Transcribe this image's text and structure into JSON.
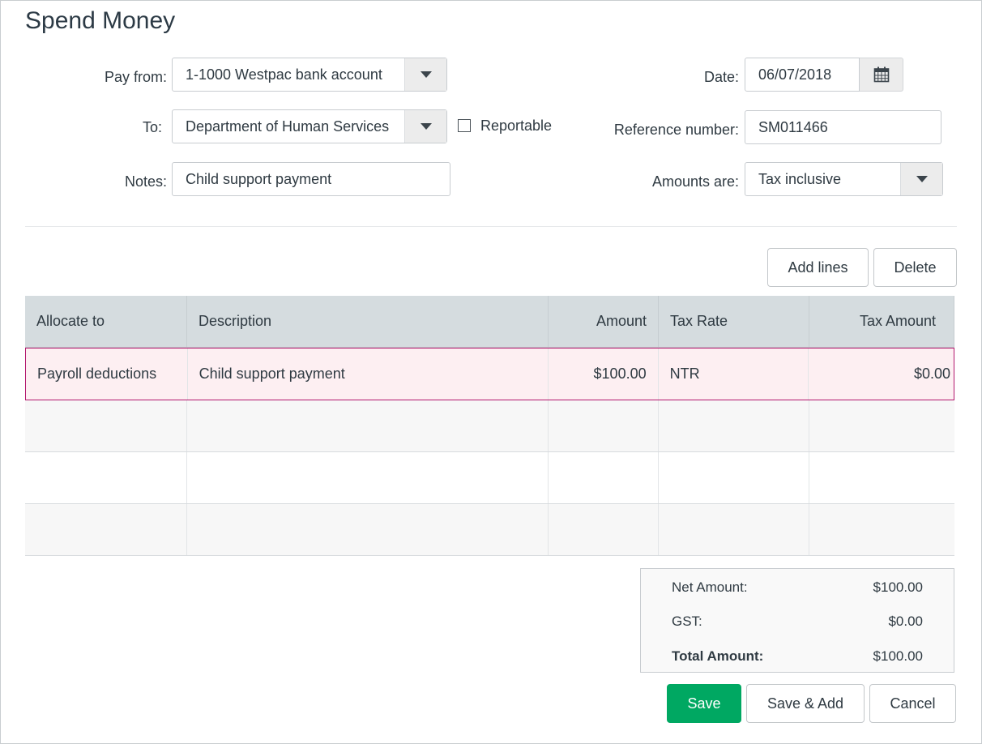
{
  "page": {
    "title": "Spend Money"
  },
  "form": {
    "pay_from": {
      "label": "Pay from:",
      "value": "1-1000 Westpac bank account"
    },
    "to": {
      "label": "To:",
      "value": "Department of Human Services"
    },
    "reportable": {
      "label": "Reportable",
      "checked": false
    },
    "notes": {
      "label": "Notes:",
      "value": "Child support payment"
    },
    "date": {
      "label": "Date:",
      "value": "06/07/2018"
    },
    "reference": {
      "label": "Reference number:",
      "value": "SM011466"
    },
    "amounts_are": {
      "label": "Amounts are:",
      "value": "Tax inclusive"
    }
  },
  "line_actions": {
    "add_lines": "Add lines",
    "delete": "Delete"
  },
  "table": {
    "columns": [
      "Allocate to",
      "Description",
      "Amount",
      "Tax Rate",
      "Tax Amount"
    ],
    "rows": [
      [
        "Payroll deductions",
        "Child support payment",
        "$100.00",
        "NTR",
        "$0.00"
      ]
    ]
  },
  "totals": {
    "net_label": "Net Amount:",
    "net_value": "$100.00",
    "gst_label": "GST:",
    "gst_value": "$0.00",
    "total_label": "Total Amount:",
    "total_value": "$100.00"
  },
  "footer": {
    "save": "Save",
    "save_add": "Save & Add",
    "cancel": "Cancel"
  },
  "colors": {
    "primary": "#00a862",
    "selected_row_border": "#b3176d",
    "header_bg": "#d5dcdf"
  },
  "icons": {
    "calendar": "calendar-icon",
    "dropdown": "chevron-down-icon"
  }
}
